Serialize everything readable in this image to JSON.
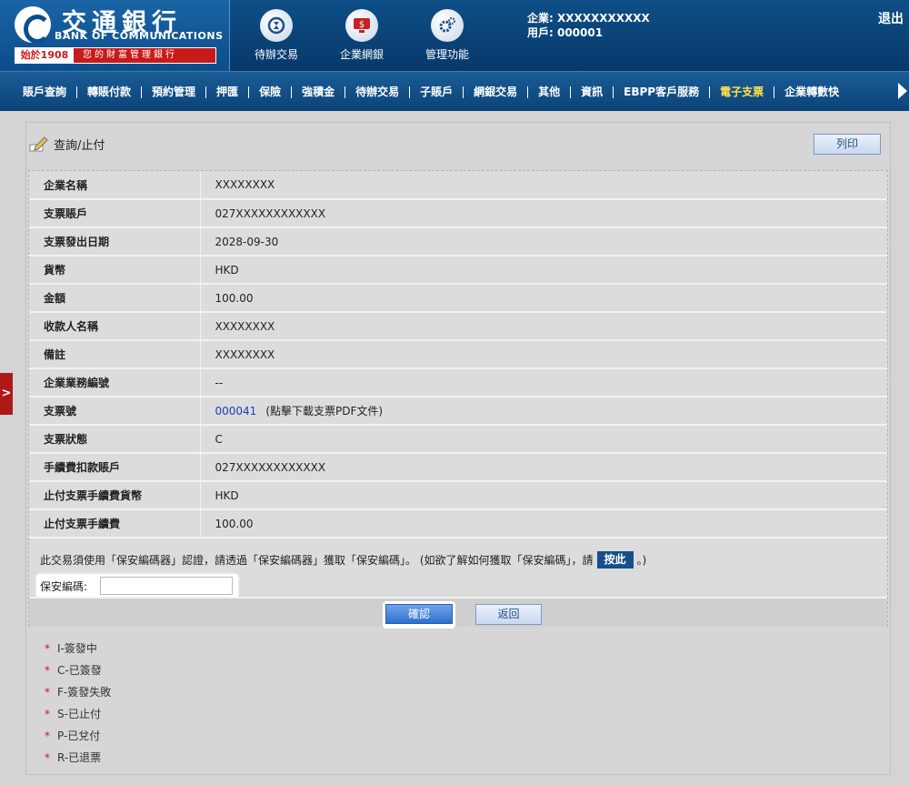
{
  "header": {
    "logo_cn": "交通銀行",
    "logo_en": "BANK OF COMMUNICATIONS",
    "logo_since": "始於1908",
    "logo_slogan": "您的財富管理銀行",
    "icons": [
      {
        "label": "待辦交易",
        "icon": "pending-transactions-icon"
      },
      {
        "label": "企業網銀",
        "icon": "corporate-banking-icon"
      },
      {
        "label": "管理功能",
        "icon": "management-gear-icon"
      }
    ],
    "company_line": "企業: XXXXXXXXXXX",
    "user_line": "用戶: 000001",
    "logout_label": "退出"
  },
  "nav": {
    "items": [
      "賬戶查詢",
      "轉賬付款",
      "預約管理",
      "押匯",
      "保險",
      "強積金",
      "待辦交易",
      "子賬戶",
      "網銀交易",
      "其他",
      "資訊",
      "EBPP客戶服務",
      "電子支票",
      "企業轉數快"
    ],
    "active_index": 12
  },
  "side_tab": {
    "label": ">"
  },
  "page": {
    "title": "查詢/止付",
    "print_label": "列印"
  },
  "details": [
    {
      "key": "企業名稱",
      "value": "XXXXXXXX"
    },
    {
      "key": "支票賬戶",
      "value": "027XXXXXXXXXXXX"
    },
    {
      "key": "支票發出日期",
      "value": "2028-09-30"
    },
    {
      "key": "貨幣",
      "value": "HKD"
    },
    {
      "key": "金額",
      "value": "100.00"
    },
    {
      "key": "收款人名稱",
      "value": "XXXXXXXX"
    },
    {
      "key": "備註",
      "value": "XXXXXXXX"
    },
    {
      "key": "企業業務編號",
      "value": "--"
    },
    {
      "key": "支票號",
      "value": "000041",
      "extra": "(點擊下載支票PDF文件)"
    },
    {
      "key": "支票狀態",
      "value": "C"
    },
    {
      "key": "手續費扣款賬戶",
      "value": "027XXXXXXXXXXXX"
    },
    {
      "key": "止付支票手續費貨幣",
      "value": "HKD"
    },
    {
      "key": "止付支票手續費",
      "value": "100.00"
    }
  ],
  "security": {
    "note_before": "此交易須使用「保安編碼器」認證，請透過「保安編碼器」獲取「保安編碼」。 (如欲了解如何獲取「保安編碼」，請",
    "here_label": "按此",
    "note_after": "。)",
    "code_label": "保安編碼:",
    "code_value": ""
  },
  "buttons": {
    "confirm": "確認",
    "back": "返回"
  },
  "legend": [
    "I-簽發中",
    "C-已簽發",
    "F-簽發失敗",
    "S-已止付",
    "P-已兌付",
    "R-已退票"
  ],
  "colors": {
    "header_blue": "#0b4378",
    "active_nav": "#ffe34d",
    "link_blue": "#1a3fb8",
    "legend_star": "#c31a1a"
  }
}
